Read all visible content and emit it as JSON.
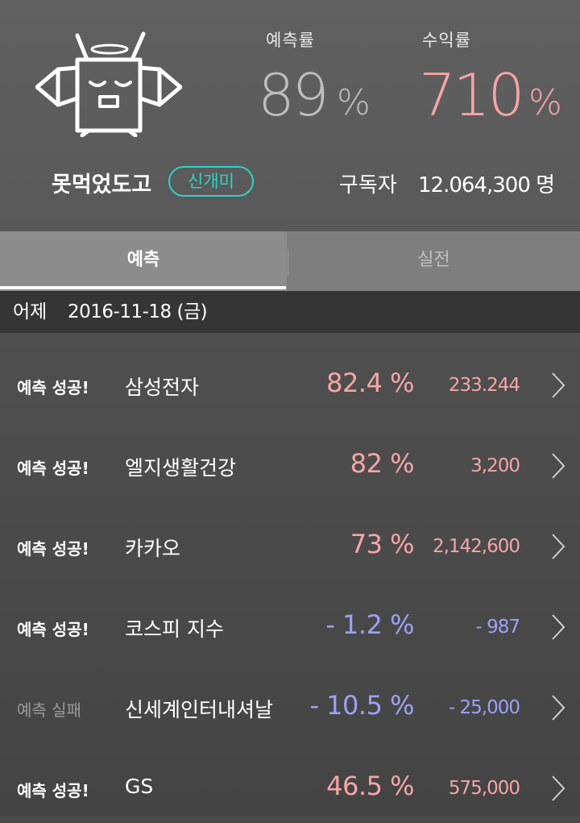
{
  "profile": {
    "stats": {
      "rate_label": "예측률",
      "rate_value": "89",
      "rate_unit": "%",
      "profit_label": "수익률",
      "profit_value": "710",
      "profit_unit": "%"
    },
    "username": "못먹었도고",
    "rank_badge": "신개미",
    "subscribers_label": "구독자",
    "subscribers_count": "12.064,300 명"
  },
  "tabs": [
    {
      "label": "예측",
      "active": true
    },
    {
      "label": "실전",
      "active": false
    }
  ],
  "date_bar": {
    "label": "어제",
    "date": "2016-11-18 (금)"
  },
  "colors": {
    "accent_teal": "#2fd3c6",
    "positive": "#f6a5a5",
    "negative": "#9aa2f4",
    "rate_gray": "#bdbdbd"
  },
  "predictions": [
    {
      "result": "예측 성공!",
      "success": true,
      "name": "삼성전자",
      "pct": "82.4 %",
      "amount": "233.244",
      "trend": "up"
    },
    {
      "result": "예측 성공!",
      "success": true,
      "name": "엘지생활건강",
      "pct": "82 %",
      "amount": "3,200",
      "trend": "up"
    },
    {
      "result": "예측 성공!",
      "success": true,
      "name": "카카오",
      "pct": "73 %",
      "amount": "2,142,600",
      "trend": "up"
    },
    {
      "result": "예측 성공!",
      "success": true,
      "name": "코스피 지수",
      "pct": "- 1.2 %",
      "amount": "- 987",
      "trend": "down"
    },
    {
      "result": "예측 실패",
      "success": false,
      "name": "신세계인터내셔날",
      "pct": "- 10.5 %",
      "amount": "- 25,000",
      "trend": "down"
    },
    {
      "result": "예측 성공!",
      "success": true,
      "name": "GS",
      "pct": "46.5 %",
      "amount": "575,000",
      "trend": "up"
    }
  ]
}
